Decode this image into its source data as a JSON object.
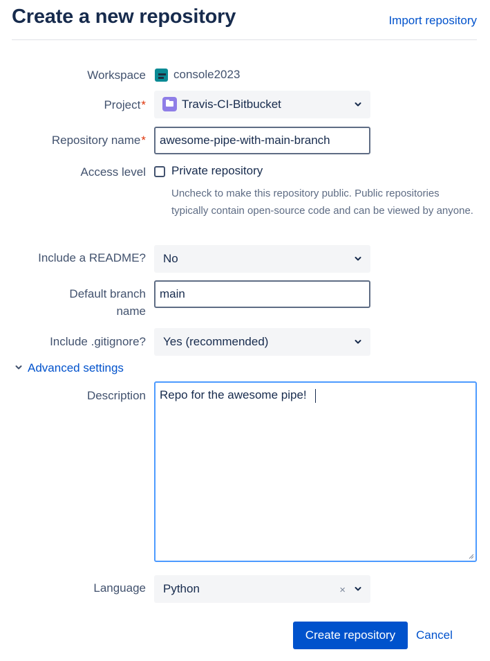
{
  "header": {
    "title": "Create a new repository",
    "import_link": "Import repository"
  },
  "form": {
    "workspace": {
      "label": "Workspace",
      "value": "console2023"
    },
    "project": {
      "label": "Project",
      "required_mark": "*",
      "value": "Travis-CI-Bitbucket"
    },
    "repository_name": {
      "label": "Repository name",
      "required_mark": "*",
      "value": "awesome-pipe-with-main-branch"
    },
    "access_level": {
      "label": "Access level",
      "checkbox_label": "Private repository",
      "checked": false,
      "help": "Uncheck to make this repository public. Public repositories typically contain open-source code and can be viewed by anyone."
    },
    "readme": {
      "label": "Include a README?",
      "value": "No"
    },
    "default_branch": {
      "label_line1": "Default branch",
      "label_line2": "name",
      "value": "main"
    },
    "gitignore": {
      "label": "Include .gitignore?",
      "value": "Yes (recommended)"
    },
    "advanced": {
      "label": "Advanced settings"
    },
    "description": {
      "label": "Description",
      "value": "Repo for the awesome pipe!"
    },
    "language": {
      "label": "Language",
      "value": "Python",
      "clear_glyph": "×"
    }
  },
  "actions": {
    "create_label": "Create repository",
    "cancel_label": "Cancel"
  },
  "colors": {
    "primary": "#0052cc",
    "title": "#172b4d",
    "label": "#42526e",
    "required": "#de350b",
    "focus_border": "#4c9aff",
    "workspace_avatar": "#0a8a94",
    "project_avatar": "#8f7ee7"
  },
  "icons": {
    "workspace": "workspace-avatar-icon",
    "project": "folder-icon",
    "dropdown": "chevron-down-icon",
    "advanced_toggle": "chevron-down-icon",
    "clear": "clear-icon",
    "resize": "resize-handle-icon"
  }
}
